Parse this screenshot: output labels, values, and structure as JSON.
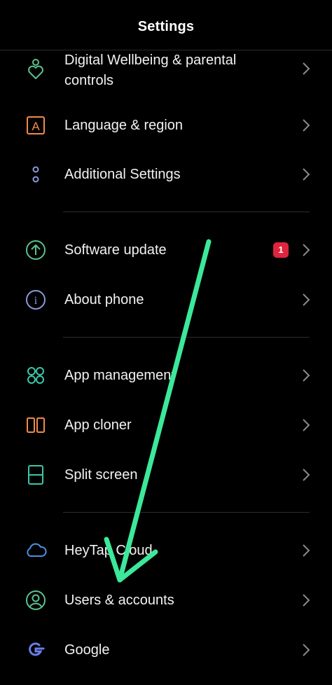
{
  "header": {
    "title": "Settings"
  },
  "items": [
    {
      "label_line1": "Digital Wellbeing & parental",
      "label_line2": "controls",
      "icon": "wellbeing-icon",
      "color": "#5ac18e"
    },
    {
      "label": "Language & region",
      "icon": "language-icon",
      "color": "#f08a4b",
      "glyph": "A"
    },
    {
      "label": "Additional Settings",
      "icon": "more-dots-icon",
      "color": "#8a9ad6"
    },
    {
      "label": "Software update",
      "icon": "update-arrow-icon",
      "color": "#5ac18e",
      "badge": "1"
    },
    {
      "label": "About phone",
      "icon": "info-icon",
      "color": "#8a9ad6",
      "glyph": "i"
    },
    {
      "label": "App management",
      "icon": "app-grid-icon",
      "color": "#3cc6a8"
    },
    {
      "label": "App cloner",
      "icon": "app-cloner-icon",
      "color": "#f08a4b"
    },
    {
      "label": "Split screen",
      "icon": "split-screen-icon",
      "color": "#3cc6a8"
    },
    {
      "label": "HeyTap Cloud",
      "icon": "cloud-icon",
      "color": "#4a90e2"
    },
    {
      "label": "Users & accounts",
      "icon": "user-icon",
      "color": "#5ac18e"
    },
    {
      "label": "Google",
      "icon": "google-icon",
      "color": "#6b7de6",
      "glyph": "G"
    }
  ],
  "colors": {
    "badge": "#e0243d",
    "annotation_arrow": "#3ce89a",
    "chevron": "#8a8a8a"
  }
}
